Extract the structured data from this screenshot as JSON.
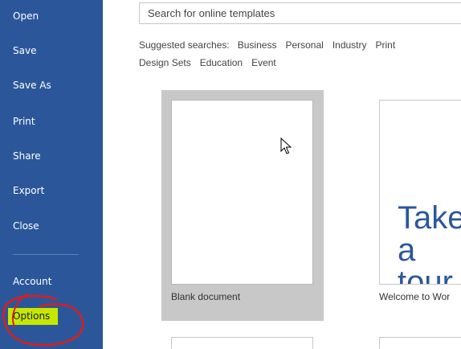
{
  "sidebar": {
    "items": [
      {
        "label": "Open"
      },
      {
        "label": "Save"
      },
      {
        "label": "Save As"
      },
      {
        "label": "Print"
      },
      {
        "label": "Share"
      },
      {
        "label": "Export"
      },
      {
        "label": "Close"
      },
      {
        "label": "Account"
      },
      {
        "label": "Options"
      }
    ],
    "background_color": "#2b579a",
    "highlight_color": "#c6e800",
    "annotation_color": "#e01b1b"
  },
  "search": {
    "placeholder": "Search for online templates"
  },
  "suggested": {
    "label": "Suggested searches:",
    "links": [
      "Business",
      "Personal",
      "Industry",
      "Print",
      "Design Sets",
      "Education",
      "Event"
    ]
  },
  "templates": [
    {
      "caption": "Blank document",
      "selected": true
    },
    {
      "caption": "Welcome to Wor",
      "preview_text": "Take a\ntour"
    }
  ],
  "cursor": {
    "icon": "arrow-pointer-icon"
  }
}
